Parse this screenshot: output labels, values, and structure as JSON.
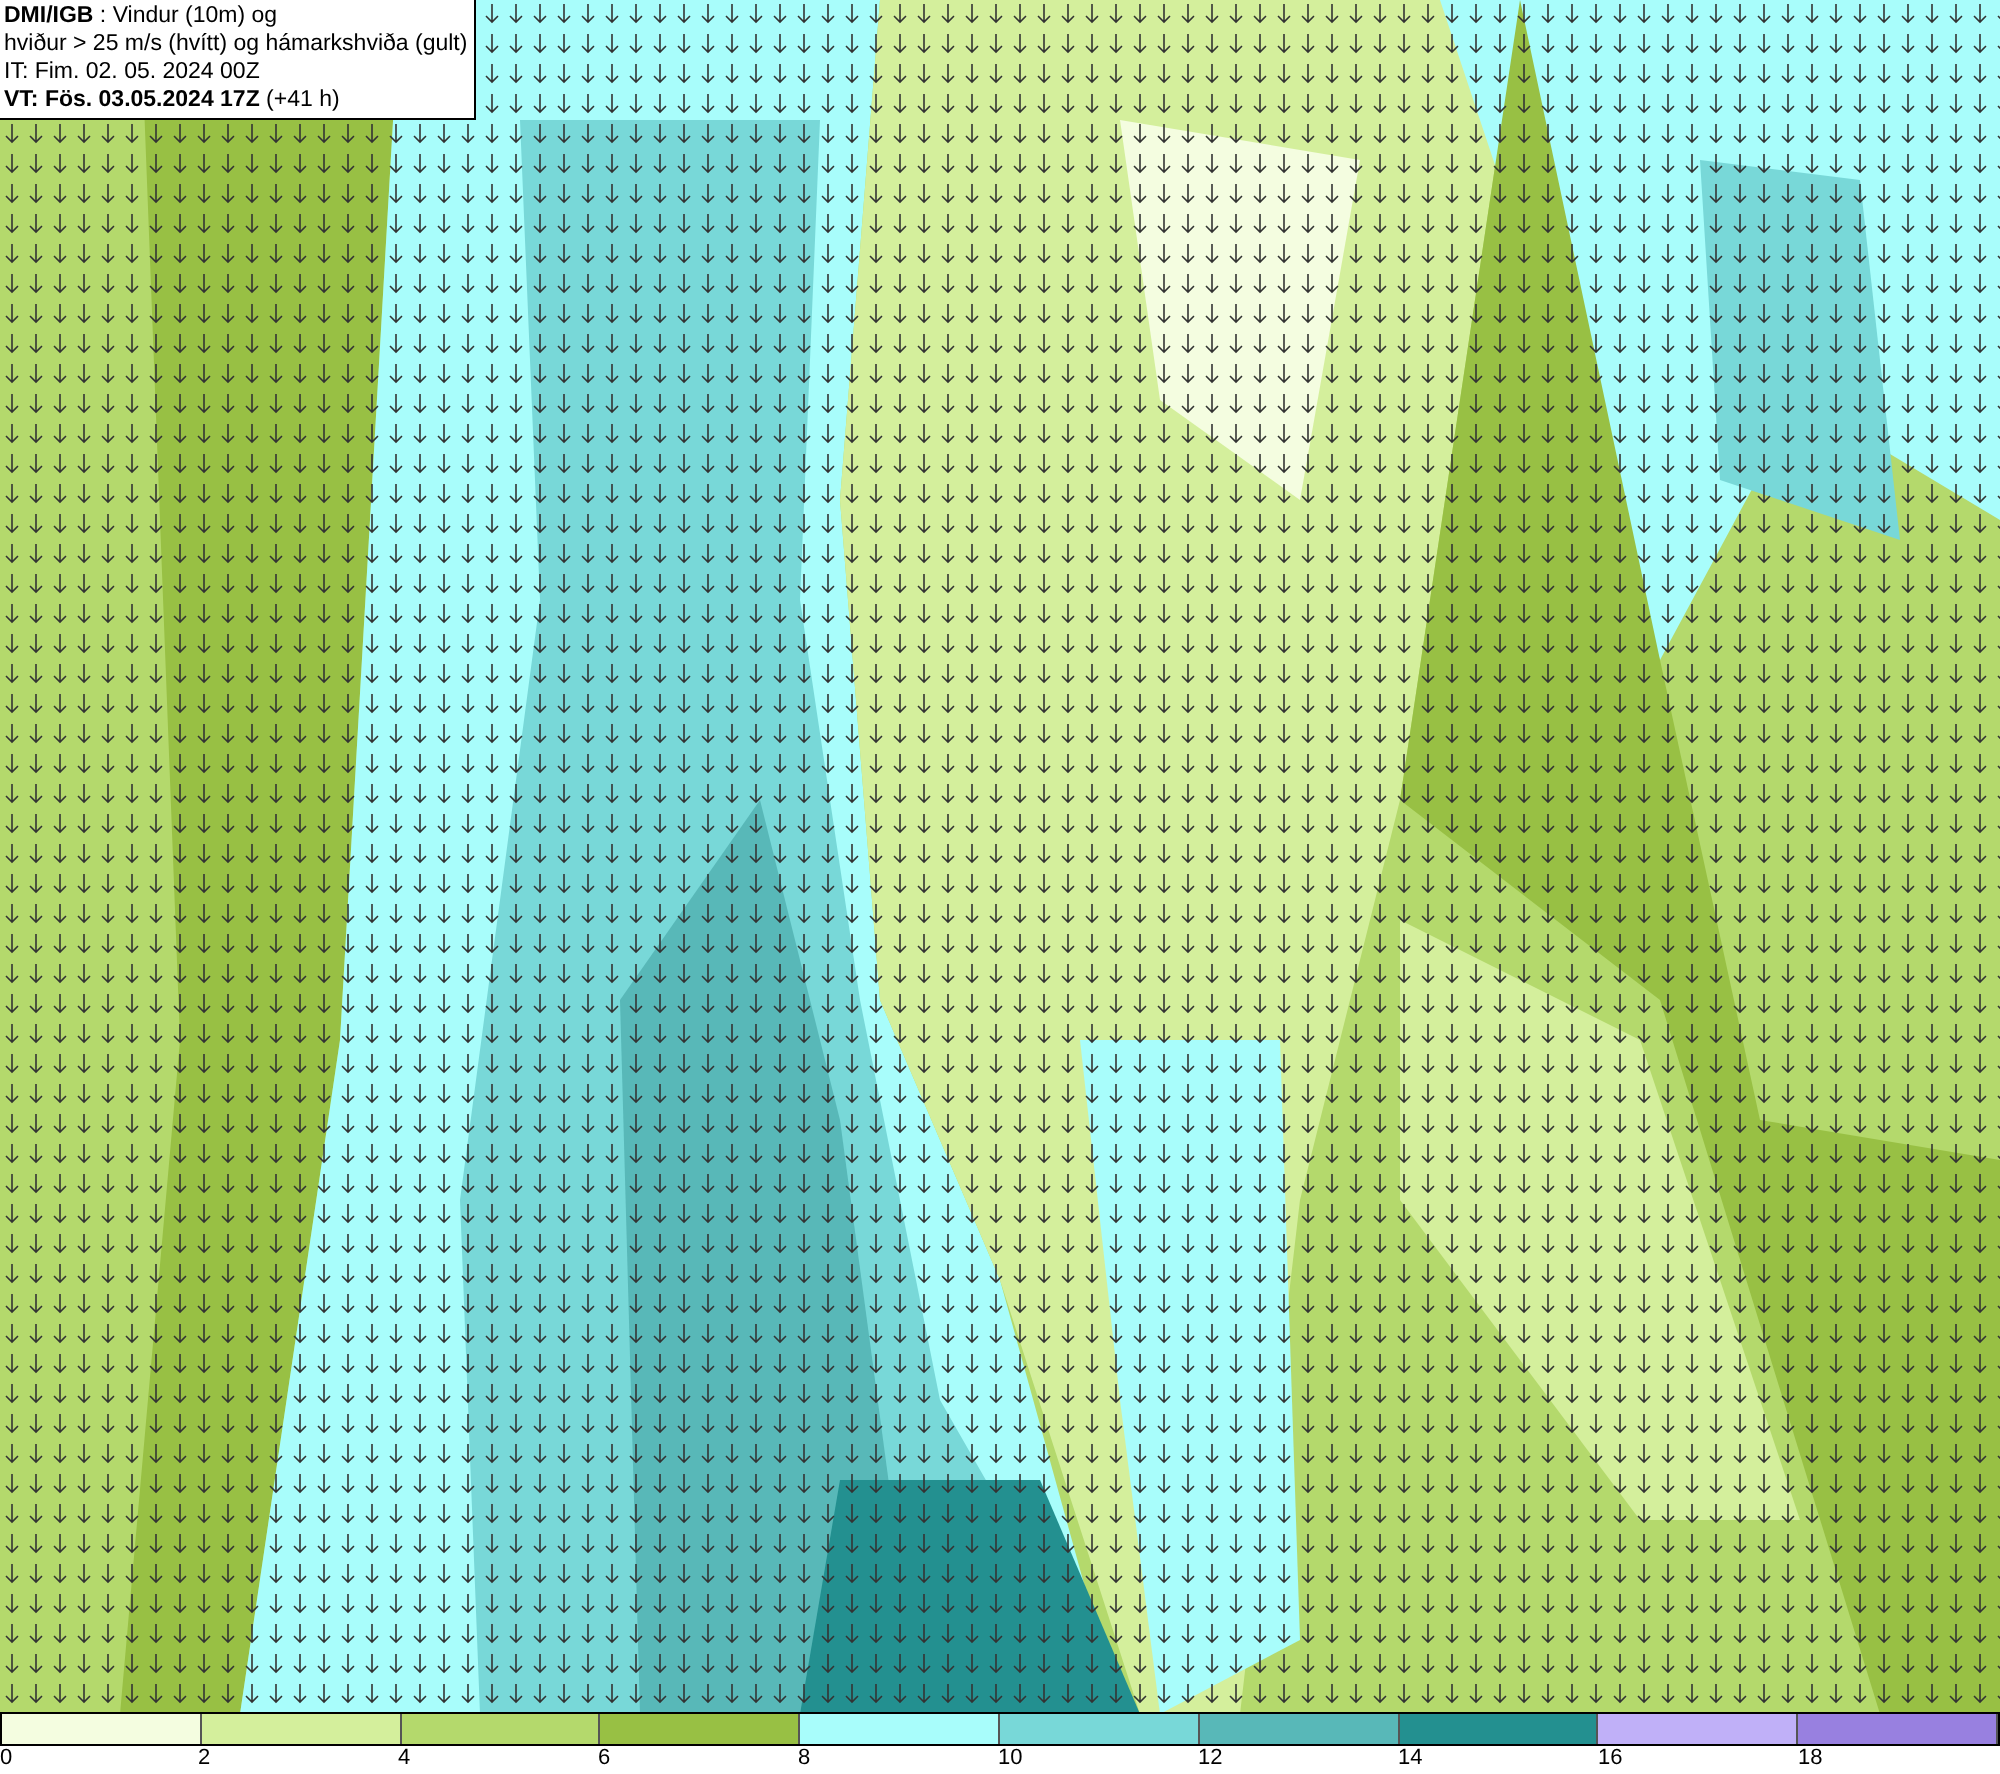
{
  "header": {
    "lines": [
      "**DMI/IGB** : Vindur (10m) og",
      "hviður > 25 m/s (hvítt) og hámarkshviða (gult)",
      "IT: Fim. 02. 05. 2024 00Z",
      "**VT: Fös. 03.05.2024 17Z** (+41 h)"
    ]
  },
  "legend": [
    {
      "label": "0",
      "color": "#f4fde0"
    },
    {
      "label": "2",
      "color": "#d4ef9c"
    },
    {
      "label": "4",
      "color": "#b4d96c"
    },
    {
      "label": "6",
      "color": "#98c044"
    },
    {
      "label": "8",
      "color": "#a8fdfb"
    },
    {
      "label": "10",
      "color": "#78d8d8"
    },
    {
      "label": "12",
      "color": "#58b8b8"
    },
    {
      "label": "14",
      "color": "#239090"
    },
    {
      "label": "16",
      "color": "#c0b0f8"
    },
    {
      "label": "18",
      "color": "#9880e0"
    }
  ]
}
